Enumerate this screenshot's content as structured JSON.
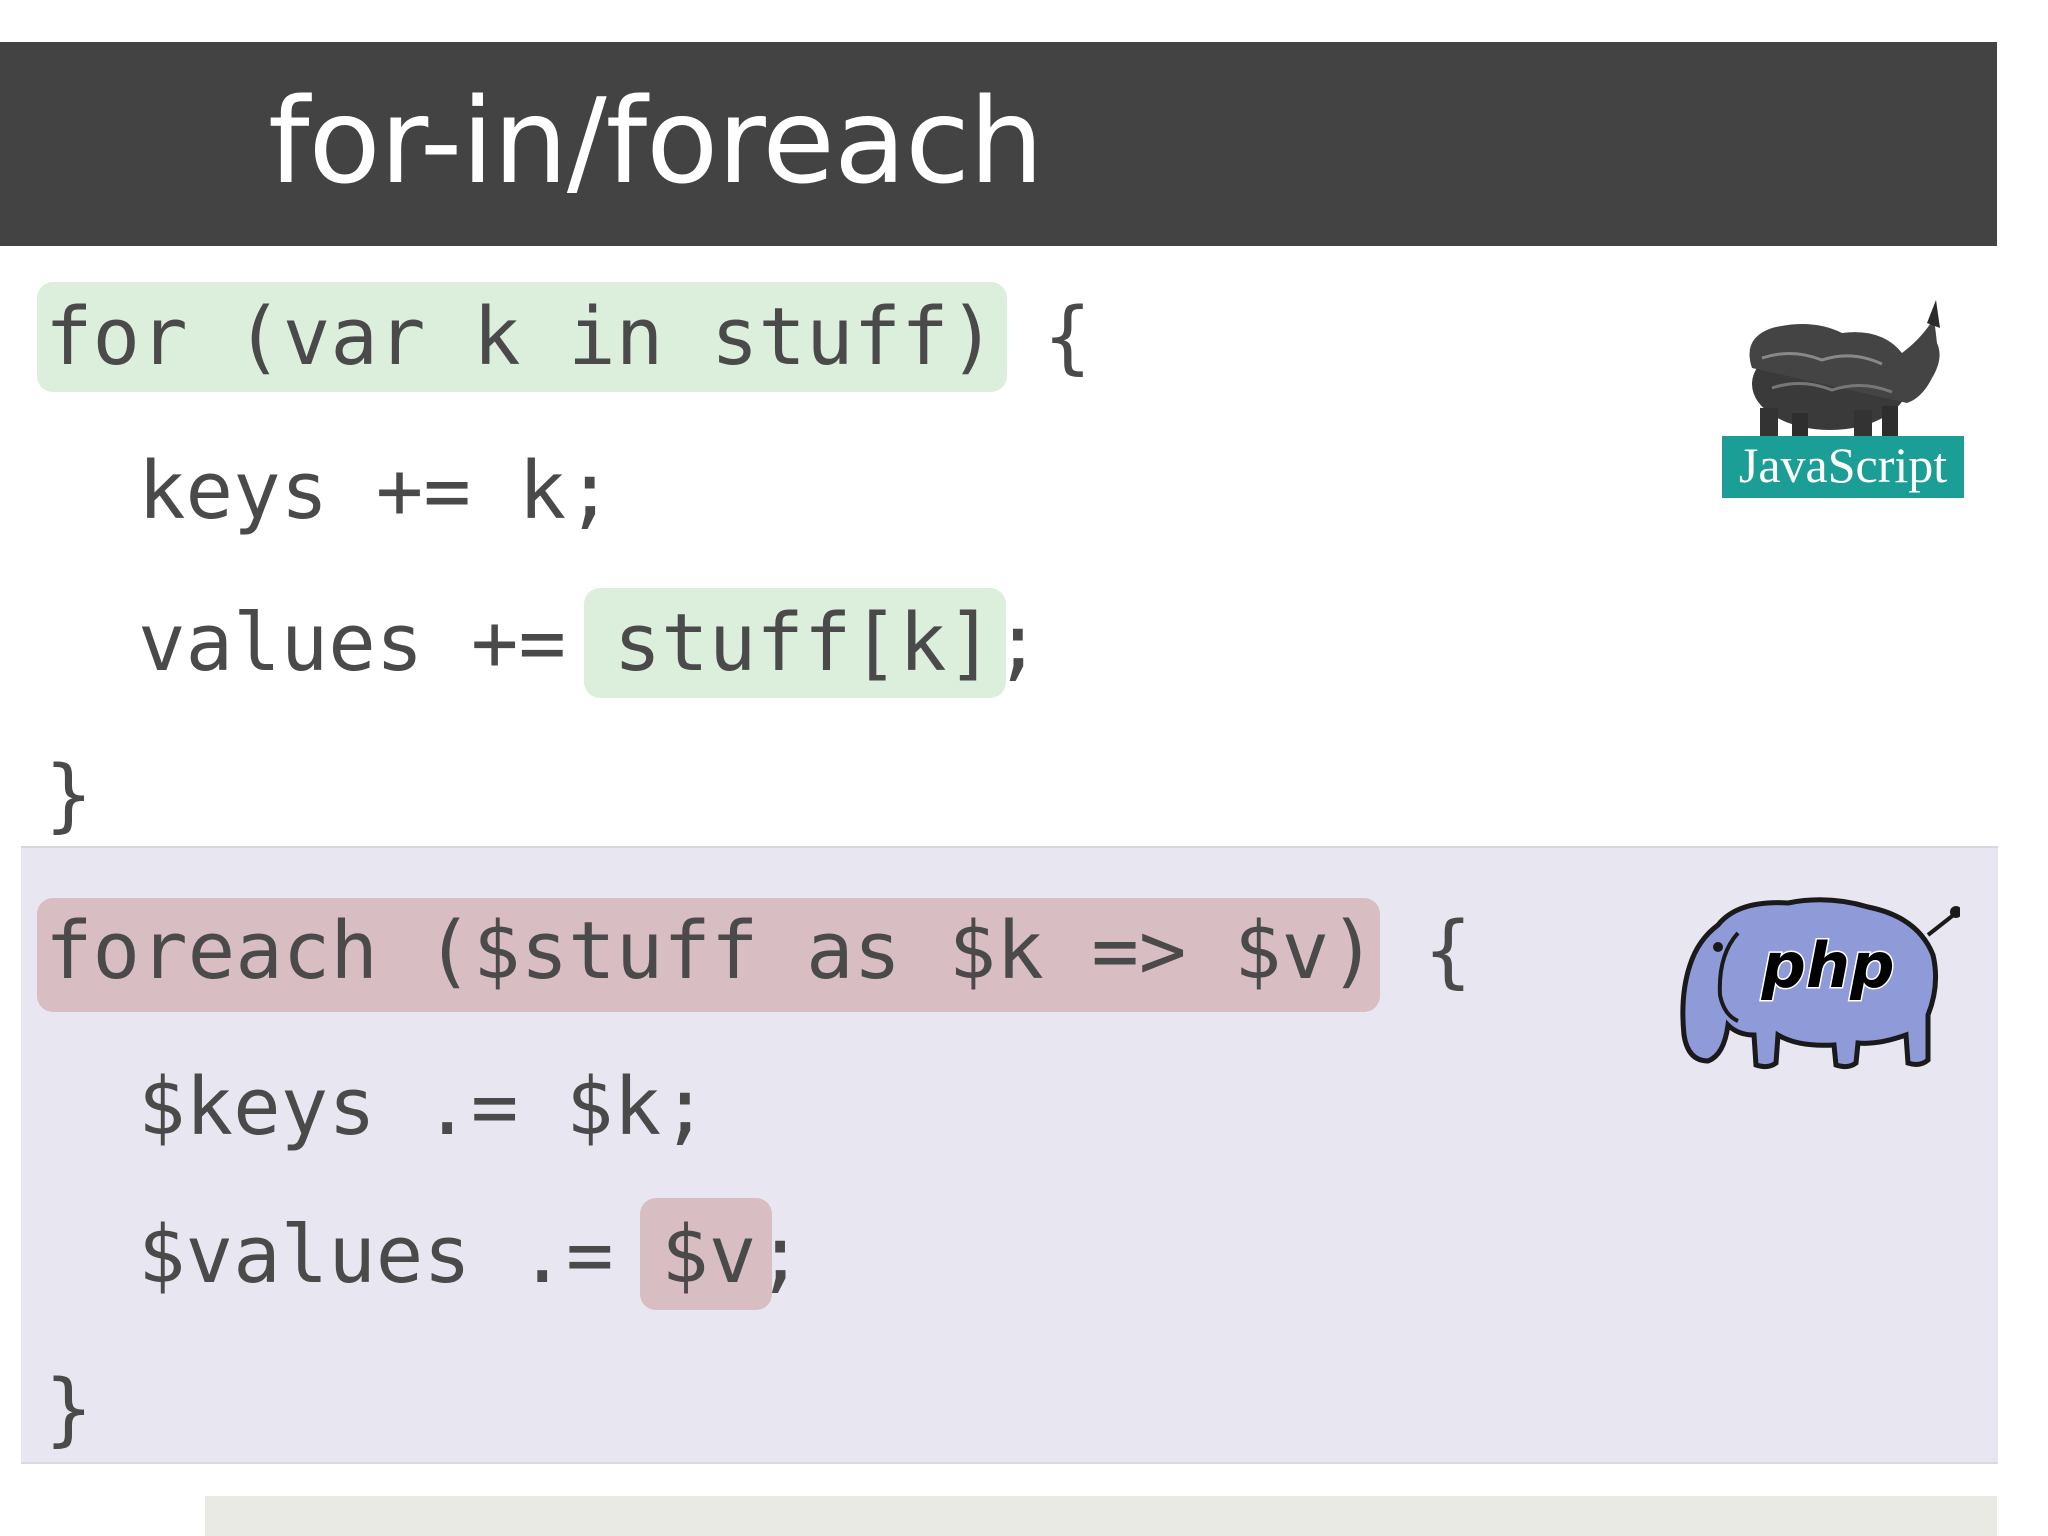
{
  "slide": {
    "title": "for-in/foreach"
  },
  "js_code": {
    "line1_highlight": "for (var k in stuff)",
    "line1_rest": " {",
    "line2": "keys += k;",
    "line3_prefix": "values += ",
    "line3_highlight": "stuff[k]",
    "line3_rest": ";",
    "line4": "}"
  },
  "php_code": {
    "line1_highlight": "foreach ($stuff as $k => $v)",
    "line1_rest": " {",
    "line2": "$keys .= $k;",
    "line3_prefix": "$values .= ",
    "line3_highlight": "$v",
    "line3_rest": ";",
    "line4": "}"
  },
  "logos": {
    "javascript": {
      "label": "JavaScript",
      "icon": "rhino-icon",
      "color": "#1a9e96"
    },
    "php": {
      "label": "php",
      "icon": "elephant-icon",
      "color": "#8f9ad8"
    }
  },
  "colors": {
    "title_bar": "#434343",
    "js_highlight": "#dcefdc",
    "php_highlight": "#d8bdc2",
    "php_panel": "#e8e7f1"
  }
}
